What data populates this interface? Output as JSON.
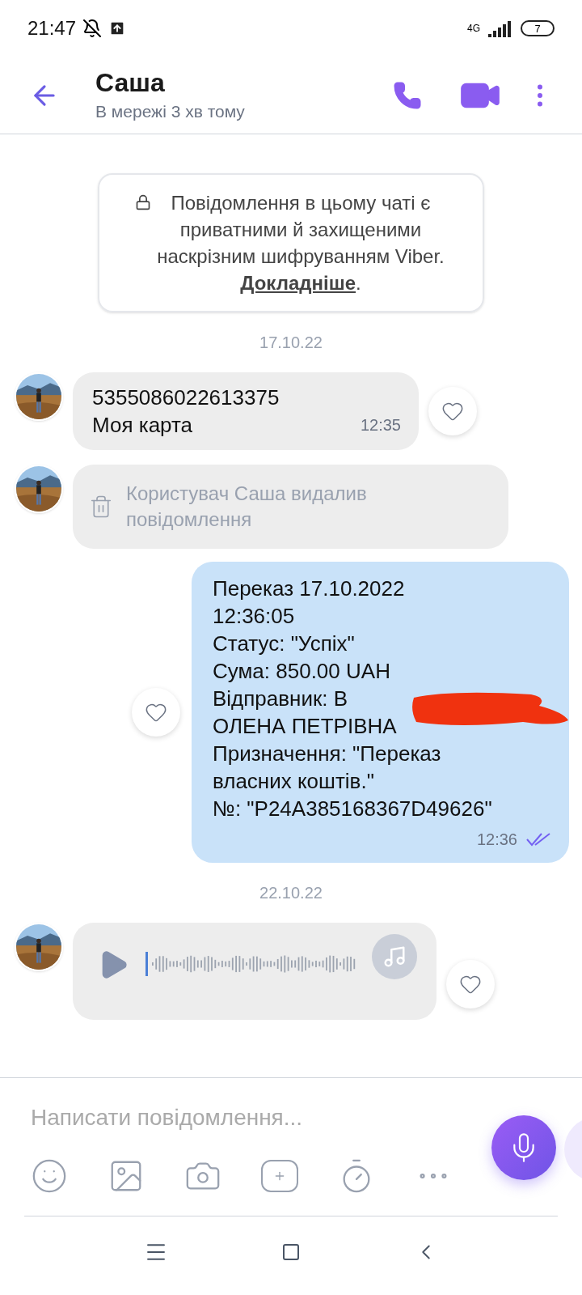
{
  "status_bar": {
    "time": "21:47",
    "network": "4G",
    "battery": "7"
  },
  "header": {
    "name": "Саша",
    "presence": "В мережі 3 хв тому"
  },
  "privacy_notice": {
    "text": "Повідомлення в цьому чаті є приватними й захищеними наскрізним шифруванням Viber. ",
    "link": "Докладніше",
    "end": "."
  },
  "messages": [
    {
      "kind": "date",
      "text": "17.10.22"
    },
    {
      "kind": "incoming_text",
      "text": "5355086022613375\nМоя карта",
      "time": "12:35"
    },
    {
      "kind": "deleted",
      "text": "Користувач Саша видалив повідомлення"
    },
    {
      "kind": "outgoing_text",
      "text": "Переказ 17.10.2022\n12:36:05\nСтатус: \"Успіх\"\nСума: 850.00 UAH\nВідправник: В\nОЛЕНА ПЕТРІВНА\nПризначення: \"Переказ\nвласних коштів.\"\n№: \"P24A385168367D49626\"",
      "time": "12:36",
      "read": true,
      "redacted": true
    },
    {
      "kind": "date",
      "text": "22.10.22"
    },
    {
      "kind": "voice"
    }
  ],
  "composer": {
    "placeholder": "Написати повідомлення..."
  }
}
